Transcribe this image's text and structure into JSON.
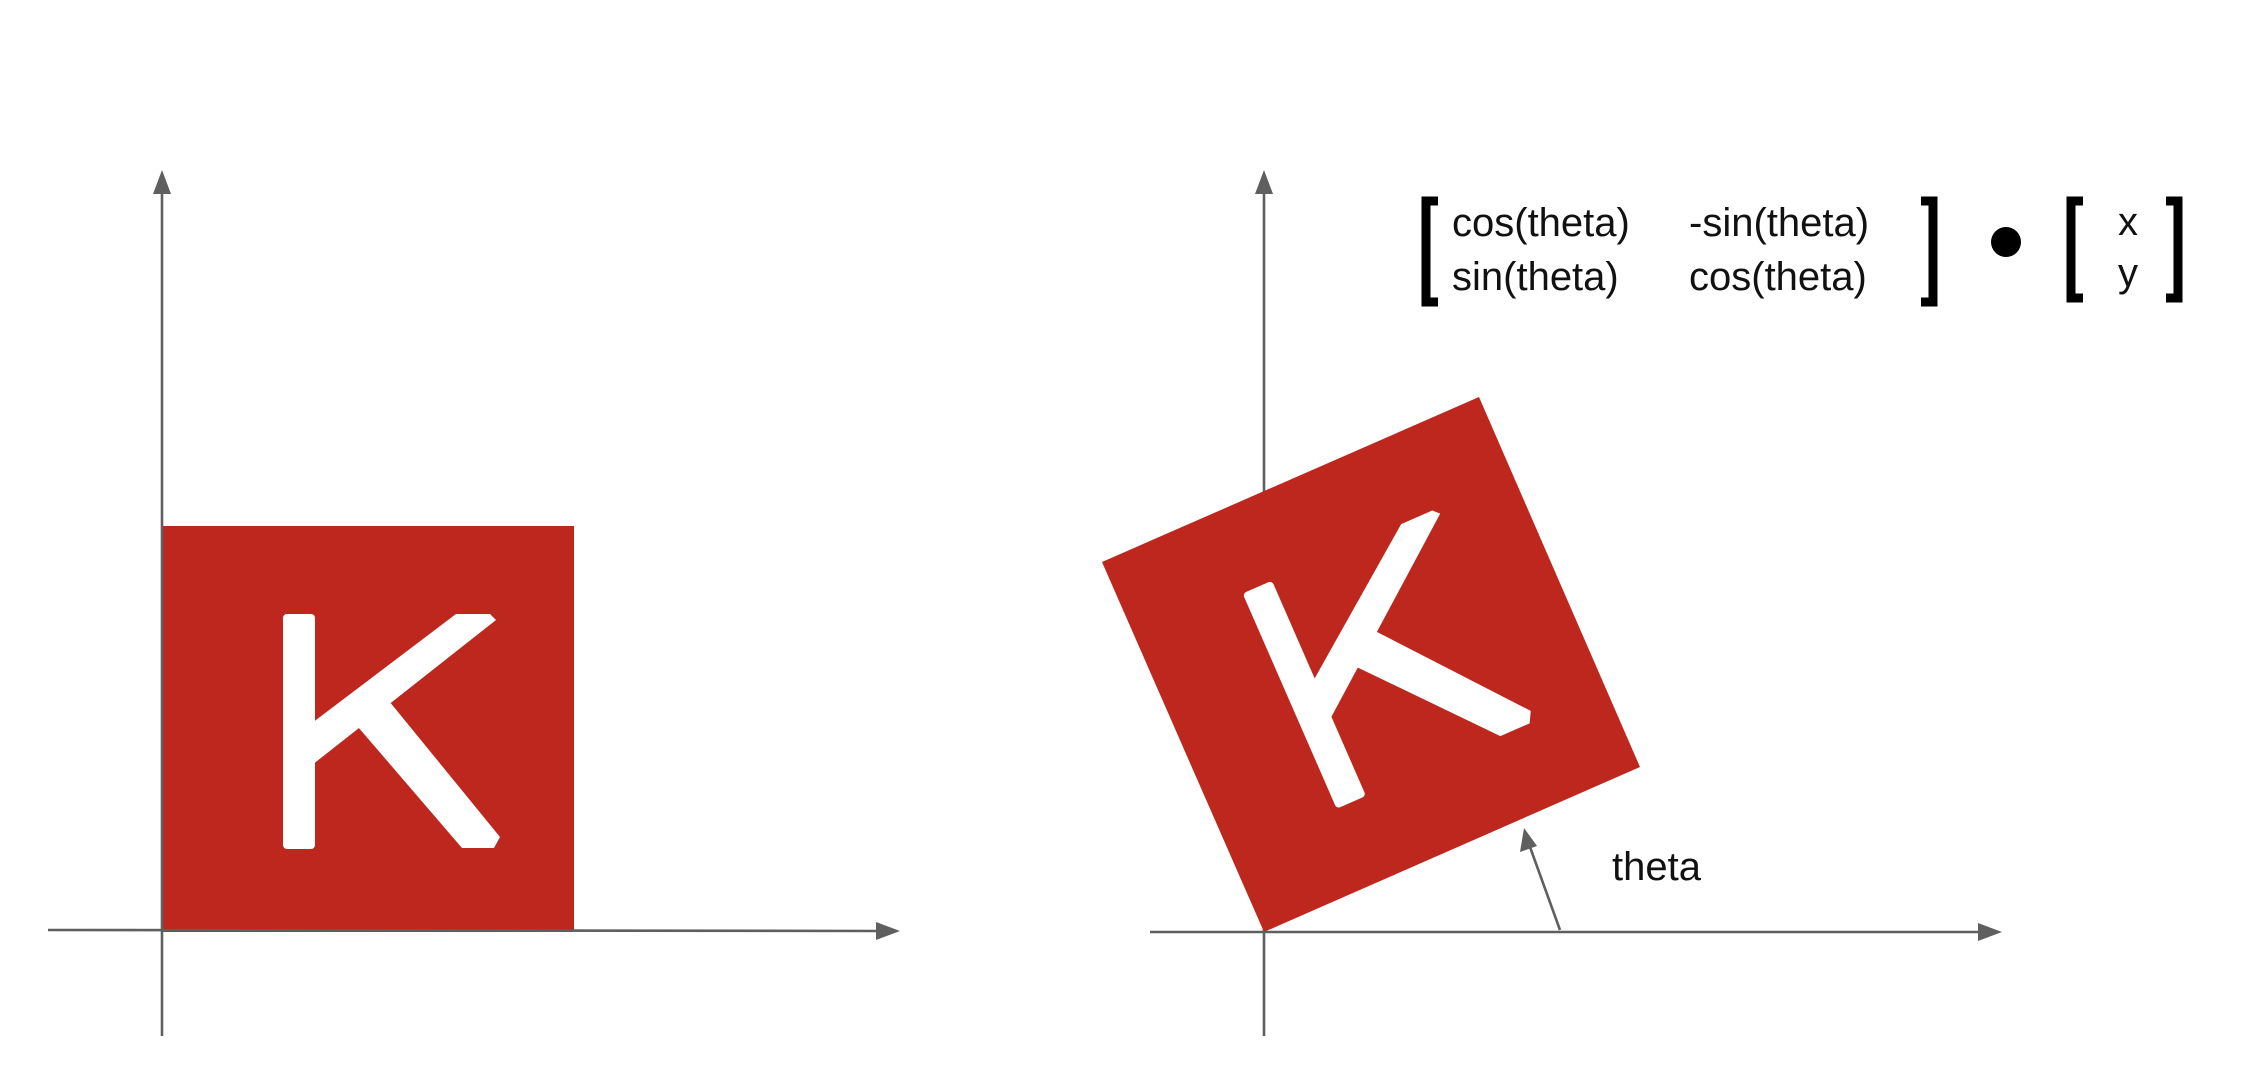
{
  "colors": {
    "tile": "#be271e",
    "letter": "#ffffff",
    "axis": "#5f5f5f",
    "text": "#111111",
    "brackets": "#000000"
  },
  "left_panel": {
    "tile_letter": "K"
  },
  "right_panel": {
    "tile_letter": "K",
    "angle_label": "theta"
  },
  "formula": {
    "matrix": [
      [
        "cos(theta)",
        "-sin(theta)"
      ],
      [
        "sin(theta)",
        "cos(theta)"
      ]
    ],
    "operator_icon": "dot-product",
    "vector": [
      "x",
      "y"
    ]
  }
}
